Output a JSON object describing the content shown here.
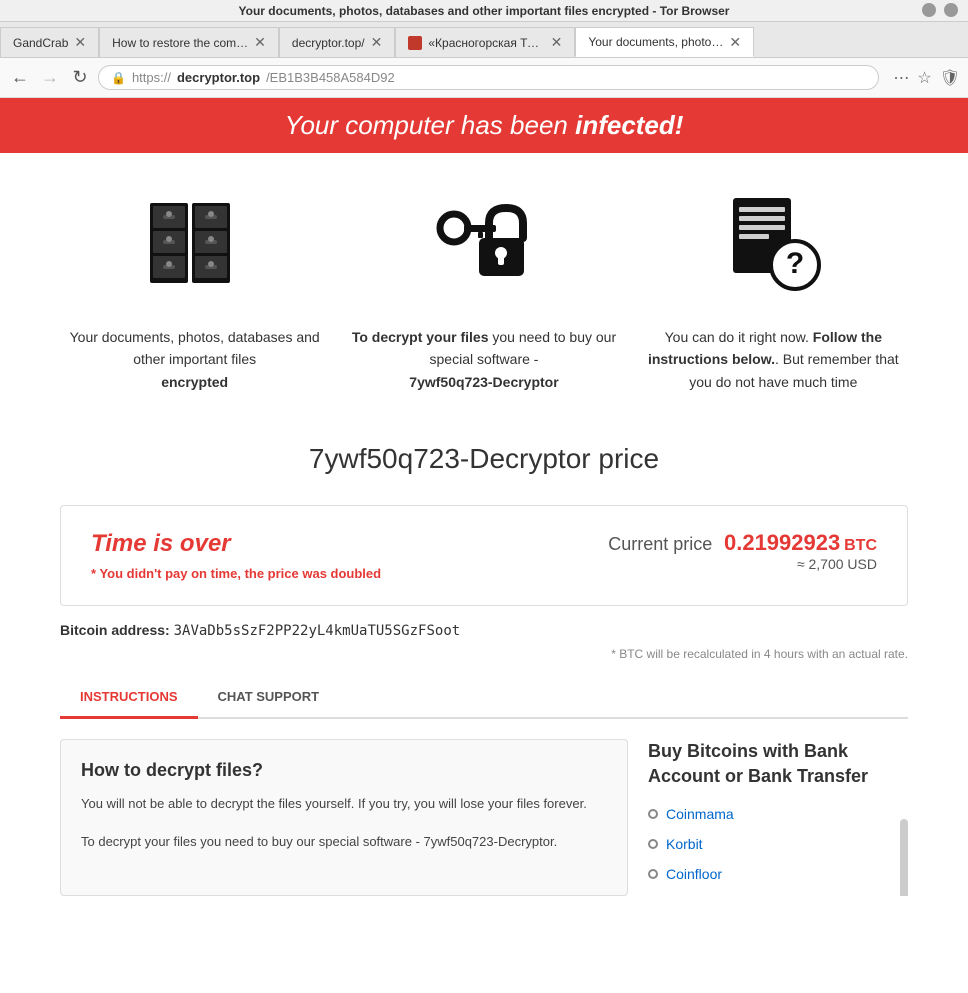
{
  "browser": {
    "notification_bar": "Your documents, photos, databases and other important files encrypted - Tor Browser",
    "tabs": [
      {
        "id": "gandcrab",
        "label": "GandCrab",
        "active": false,
        "favicon": false
      },
      {
        "id": "how-to-restore",
        "label": "How to restore the com…",
        "active": false,
        "favicon": false
      },
      {
        "id": "decryptor",
        "label": "decryptor.top/",
        "active": false,
        "favicon": false
      },
      {
        "id": "krasnaya",
        "label": "«Красногорская Ти…",
        "active": false,
        "favicon": true
      },
      {
        "id": "your-docs",
        "label": "Your documents, photo…",
        "active": true,
        "favicon": false
      }
    ],
    "address": {
      "protocol": "https://",
      "domain": "decryptor.top",
      "path": "/EB1B3B458A584D92"
    }
  },
  "page": {
    "header": {
      "text_normal": "Your computer has been ",
      "text_bold": "infected!"
    },
    "col1": {
      "text": "Your documents, photos, databases and other important files",
      "text_bold": "encrypted"
    },
    "col2": {
      "text_intro": "To decrypt your files ",
      "text_body": "you need to buy our special software -",
      "software_name": "7ywf50q723-Decryptor"
    },
    "col3": {
      "text_normal": "You can do it right now. ",
      "text_bold": "Follow the instructions below.",
      "text_end": ". But remember that you do not have much time"
    },
    "price_section": {
      "title": "7ywf50q723-Decryptor price",
      "time_over_label": "Time is over",
      "price_note_asterisk": "*",
      "price_note": " You didn't pay on time, the price was doubled",
      "current_price_label": "Current price",
      "current_price_value": "0.21992923",
      "btc_label": "BTC",
      "usd_approx": "≈ 2,700 USD",
      "bitcoin_address_label": "Bitcoin address:",
      "bitcoin_address_value": "3AVaDb5sSzF2PP22yL4kmUaTU5SGzFSoot",
      "recalc_note": "* BTC will be recalculated in 4 hours with an actual rate."
    },
    "tabs": [
      {
        "id": "instructions",
        "label": "INSTRUCTIONS",
        "active": true
      },
      {
        "id": "chat-support",
        "label": "CHAT SUPPORT",
        "active": false
      }
    ],
    "instructions": {
      "title": "How to decrypt files?",
      "para1": "You will not be able to decrypt the files yourself. If you try, you will lose your files forever.",
      "para2": "To decrypt your files you need to buy our special software - 7ywf50q723-Decryptor."
    },
    "right_panel": {
      "title": "Buy Bitcoins with Bank Account or Bank Transfer",
      "exchanges": [
        {
          "label": "Coinmama",
          "url": "#"
        },
        {
          "label": "Korbit",
          "url": "#"
        },
        {
          "label": "Coinfloor",
          "url": "#"
        }
      ]
    }
  }
}
